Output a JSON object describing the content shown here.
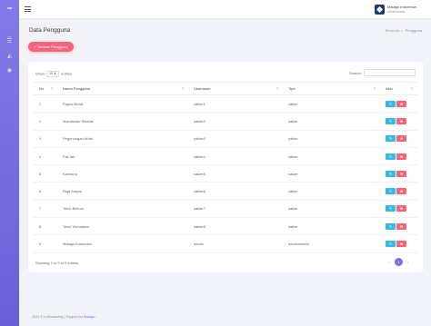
{
  "sidebar": {
    "logo": "∞",
    "icons": [
      {
        "name": "dashboard-icon",
        "glyph": "◠"
      },
      {
        "name": "list-icon",
        "glyph": "☰"
      },
      {
        "name": "chart-icon",
        "glyph": "◭"
      },
      {
        "name": "user-icon",
        "glyph": "◉"
      }
    ]
  },
  "topbar": {
    "brand_name": "Malago Indonesia",
    "brand_sub": "administrator"
  },
  "header": {
    "title": "Data Pengguna",
    "breadcrumb_home": "Beranda",
    "breadcrumb_sep": ">",
    "breadcrumb_current": "Pengguna",
    "add_button": "+ Tambah Pengguna"
  },
  "table_controls": {
    "show_label": "Show",
    "entries_value": "10",
    "entries_label": "entries",
    "search_label": "Search:",
    "search_value": ""
  },
  "table": {
    "columns": [
      "No",
      "Nama Pengguna",
      "Username",
      "Tipe",
      "Aksi"
    ],
    "rows": [
      {
        "no": "1",
        "nama": "Papua Barat",
        "username": "saiker1",
        "tipe": "saiker"
      },
      {
        "no": "2",
        "nama": "Manokwari Selatan",
        "username": "saiker2",
        "tipe": "saiker"
      },
      {
        "no": "3",
        "nama": "Pegunungan Arfak",
        "username": "saiker3",
        "tipe": "saiker"
      },
      {
        "no": "4",
        "nama": "Fak fak",
        "username": "saiker4",
        "tipe": "saiker"
      },
      {
        "no": "5",
        "nama": "Kaimana",
        "username": "saiker5",
        "tipe": "saiker"
      },
      {
        "no": "6",
        "nama": "Raja Ampat",
        "username": "saiker6",
        "tipe": "saiker"
      },
      {
        "no": "7",
        "nama": "Teluk Bintuni",
        "username": "saiker7",
        "tipe": "saiker"
      },
      {
        "no": "8",
        "nama": "Teluk Wondama",
        "username": "saiker8",
        "tipe": "saiker"
      },
      {
        "no": "9",
        "nama": "Malago Indonesia",
        "username": "admin",
        "tipe": "administrator"
      }
    ],
    "edit_icon": "✎",
    "delete_icon": "✖"
  },
  "pagination": {
    "info": "Showing 1 to 9 of 9 entries",
    "prev": "‹",
    "current": "1",
    "next": "›"
  },
  "footer": {
    "text": "2021 © e-Monitoring | Support by",
    "link": "Malago"
  },
  "colors": {
    "sidebar": "#7b6fe2",
    "accent_pink": "#f7637a",
    "accent_blue": "#36b9e6"
  }
}
